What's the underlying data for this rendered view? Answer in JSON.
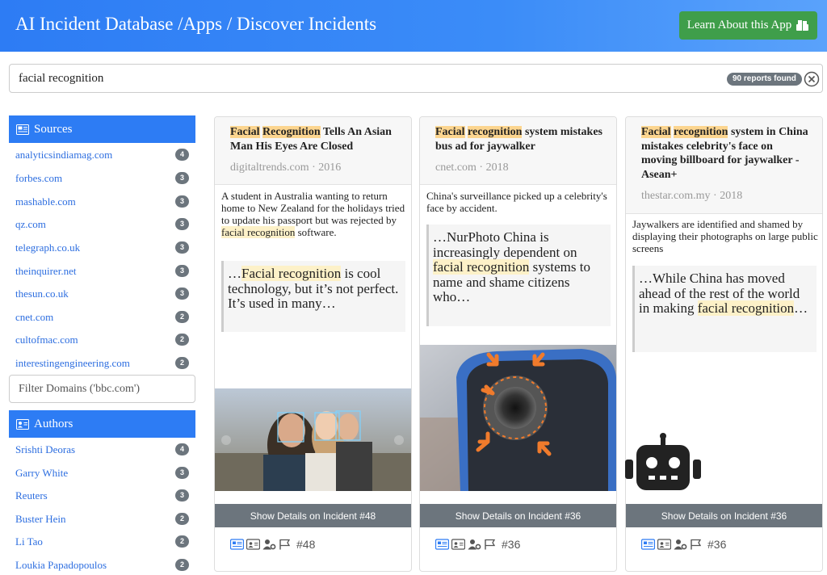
{
  "header": {
    "title": "AI Incident Database /Apps / Discover Incidents",
    "learn_button": "Learn About this App"
  },
  "search": {
    "value": "facial recognition",
    "reports_badge": "90 reports found"
  },
  "sources": {
    "heading": "Sources",
    "items": [
      {
        "label": "analyticsindiamag.com",
        "count": "4"
      },
      {
        "label": "forbes.com",
        "count": "3"
      },
      {
        "label": "mashable.com",
        "count": "3"
      },
      {
        "label": "qz.com",
        "count": "3"
      },
      {
        "label": "telegraph.co.uk",
        "count": "3"
      },
      {
        "label": "theinquirer.net",
        "count": "3"
      },
      {
        "label": "thesun.co.uk",
        "count": "3"
      },
      {
        "label": "cnet.com",
        "count": "2"
      },
      {
        "label": "cultofmac.com",
        "count": "2"
      },
      {
        "label": "interestingengineering.com",
        "count": "2"
      }
    ],
    "filter_placeholder": "Filter Domains ('bbc.com')"
  },
  "authors": {
    "heading": "Authors",
    "items": [
      {
        "label": "Srishti Deoras",
        "count": "4"
      },
      {
        "label": "Garry White",
        "count": "3"
      },
      {
        "label": "Reuters",
        "count": "3"
      },
      {
        "label": "Buster Hein",
        "count": "2"
      },
      {
        "label": "Li Tao",
        "count": "2"
      },
      {
        "label": "Loukia Papadopoulos",
        "count": "2"
      }
    ]
  },
  "cards": [
    {
      "title_hl1": "Facial",
      "title_hl2": "Recognition",
      "title_rest": " Tells An Asian Man His Eyes Are Closed",
      "source": "digitaltrends.com · 2016",
      "desc_pre": "A student in Australia wanting to return home to New Zealand for the holidays tried to update his passport but was rejected by ",
      "desc_hl": "facial recognition",
      "desc_post": " software.",
      "quote_pre": "…",
      "quote_hl": "Facial recognition",
      "quote_post": " is cool technology, but it’s not perfect. It’s used in many…",
      "details": "Show Details on Incident #48",
      "incident_num": "#48"
    },
    {
      "title_hl1": "Facial",
      "title_hl2": "recognition",
      "title_rest": " system mistakes bus ad for jaywalker",
      "source": "cnet.com · 2018",
      "desc_pre": "China's surveillance picked up a celebrity's face by accident.",
      "quote_pre": "…NurPhoto China is increasingly dependent on ",
      "quote_hl": "facial recognition",
      "quote_post": " systems to name and shame citizens who…",
      "details": "Show Details on Incident #36",
      "incident_num": "#36"
    },
    {
      "title_hl1": "Facial",
      "title_hl2": "recognition",
      "title_rest": " system in China mistakes celebrity's face on moving billboard for jaywalker - Asean+",
      "source": "thestar.com.my · 2018",
      "desc_pre": "Jaywalkers are identified and shamed by displaying their photographs on large public screens",
      "quote_pre": "…While China has moved ahead of the rest of the world in making ",
      "quote_hl": "facial recognition",
      "quote_post": "…",
      "details": "Show Details on Incident #36",
      "incident_num": "#36"
    }
  ],
  "icons": {
    "learn": "box-icon",
    "clear": "close-circle-icon",
    "sources": "newspaper-icon",
    "authors": "id-card-icon",
    "robot": "robot-icon"
  },
  "colors": {
    "accent": "#2d7cf4",
    "success": "#3f9e4a",
    "highlight": "#fcd58f",
    "badge": "#6c757d"
  }
}
